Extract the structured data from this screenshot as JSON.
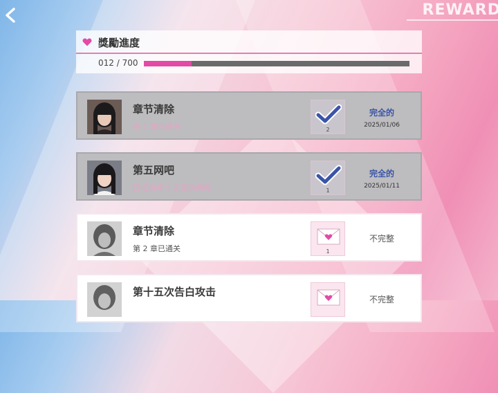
{
  "header": {
    "title": "REWARD"
  },
  "progress": {
    "title": "獎勵進度",
    "count_text": "012 / 700",
    "current": 12,
    "total": 700
  },
  "items": [
    {
      "title": "章节清除",
      "subtitle": "第 1 章已通关",
      "badge_count": "2",
      "status": "完全的",
      "date": "2025/01/06",
      "state": "complete",
      "badge_icon": "checkmark-icon",
      "avatar": "girl-portrait"
    },
    {
      "title": "第五网吧",
      "subtitle": "已成功第 5 次回访网吧",
      "badge_count": "1",
      "status": "完全的",
      "date": "2025/01/11",
      "state": "complete",
      "badge_icon": "checkmark-icon",
      "avatar": "girl-portrait"
    },
    {
      "title": "章节清除",
      "subtitle": "第 2 章已通关",
      "badge_count": "1",
      "status": "不完整",
      "date": "",
      "state": "incomplete",
      "badge_icon": "love-letter-icon",
      "avatar": "blurred-portrait"
    },
    {
      "title": "第十五次告白攻击",
      "subtitle": "",
      "badge_count": "",
      "status": "不完整",
      "date": "",
      "state": "incomplete",
      "badge_icon": "love-letter-icon",
      "avatar": "blurred-portrait"
    }
  ],
  "colors": {
    "accent_pink": "#e24aa6",
    "complete_blue": "#3a55a8"
  }
}
